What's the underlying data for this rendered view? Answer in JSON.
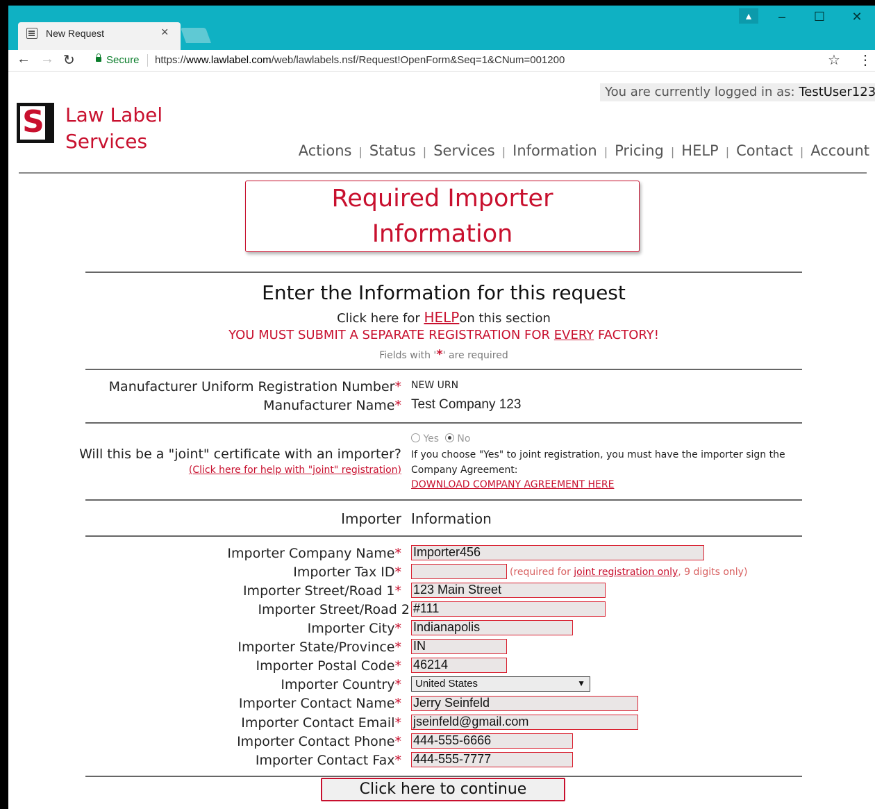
{
  "browser": {
    "tab_title": "New Request",
    "tab_close": "×",
    "secure_label": "Secure",
    "url_scheme": "https://",
    "url_domain": "www.lawlabel.com",
    "url_path": "/web/lawlabels.nsf/Request!OpenForm&Seq=1&CNum=001200"
  },
  "header": {
    "login_prefix": "You are currently logged in as: ",
    "username": "TestUser123",
    "brand_line1": "Law Label",
    "brand_line2": "Services",
    "logo_letter": "S",
    "nav": [
      "Actions",
      "Status",
      "Services",
      "Information",
      "Pricing",
      "HELP",
      "Contact",
      "Account"
    ],
    "nav_sep": "|"
  },
  "title": {
    "line1": "Required Importer",
    "line2": "Information"
  },
  "intro": {
    "heading": "Enter the Information for this request",
    "help_prefix": "Click here for ",
    "help_link": "HELP",
    "help_suffix": "on this section",
    "warn_prefix": "YOU MUST SUBMIT A SEPARATE REGISTRATION FOR ",
    "warn_emph": "EVERY",
    "warn_suffix": " FACTORY!",
    "req_prefix": "Fields with '",
    "req_star": "*",
    "req_suffix": "' are required"
  },
  "manufacturer": {
    "urn_label": "Manufacturer Uniform Registration Number",
    "urn_value": "NEW URN",
    "name_label": "Manufacturer Name",
    "name_value": "Test Company 123"
  },
  "joint": {
    "question": "Will this be a \"joint\" certificate with an importer?",
    "help_link": "(Click here for help with \"joint\" registration)",
    "yes": "Yes",
    "no": "No",
    "selected": "No",
    "note_line1": "If you choose \"Yes\" to joint registration, you must have the importer sign the",
    "note_line2": "Company Agreement:",
    "download_link": "DOWNLOAD COMPANY AGREEMENT HERE"
  },
  "section": {
    "left": "Importer",
    "right": "Information"
  },
  "star": "*",
  "fields": {
    "company_name": {
      "label": "Importer Company Name",
      "value": "Importer456",
      "required": true
    },
    "tax_id": {
      "label": "Importer Tax ID",
      "value": "",
      "required": true
    },
    "tax_note_prefix": "(required for ",
    "tax_note_link": "joint registration only",
    "tax_note_suffix": ", 9 digits only)",
    "street1": {
      "label": "Importer Street/Road 1",
      "value": "123 Main Street",
      "required": true
    },
    "street2": {
      "label": "Importer Street/Road 2",
      "value": "#111",
      "required": false
    },
    "city": {
      "label": "Importer City",
      "value": "Indianapolis",
      "required": true
    },
    "state": {
      "label": "Importer State/Province",
      "value": "IN",
      "required": true
    },
    "postal": {
      "label": "Importer Postal Code",
      "value": "46214",
      "required": true
    },
    "country": {
      "label": "Importer Country",
      "value": "United States",
      "required": true
    },
    "contact_name": {
      "label": "Importer Contact Name",
      "value": "Jerry Seinfeld",
      "required": true
    },
    "contact_email": {
      "label": "Importer Contact Email",
      "value": "jseinfeld@gmail.com",
      "required": true
    },
    "contact_phone": {
      "label": "Importer Contact Phone",
      "value": "444-555-6666",
      "required": true
    },
    "contact_fax": {
      "label": "Importer Contact Fax",
      "value": "444-555-7777",
      "required": true
    }
  },
  "continue_button": "Click here to continue",
  "colors": {
    "accent": "#c8102e",
    "titlebar": "#0fb1c3",
    "secure": "#0a7d2b"
  }
}
